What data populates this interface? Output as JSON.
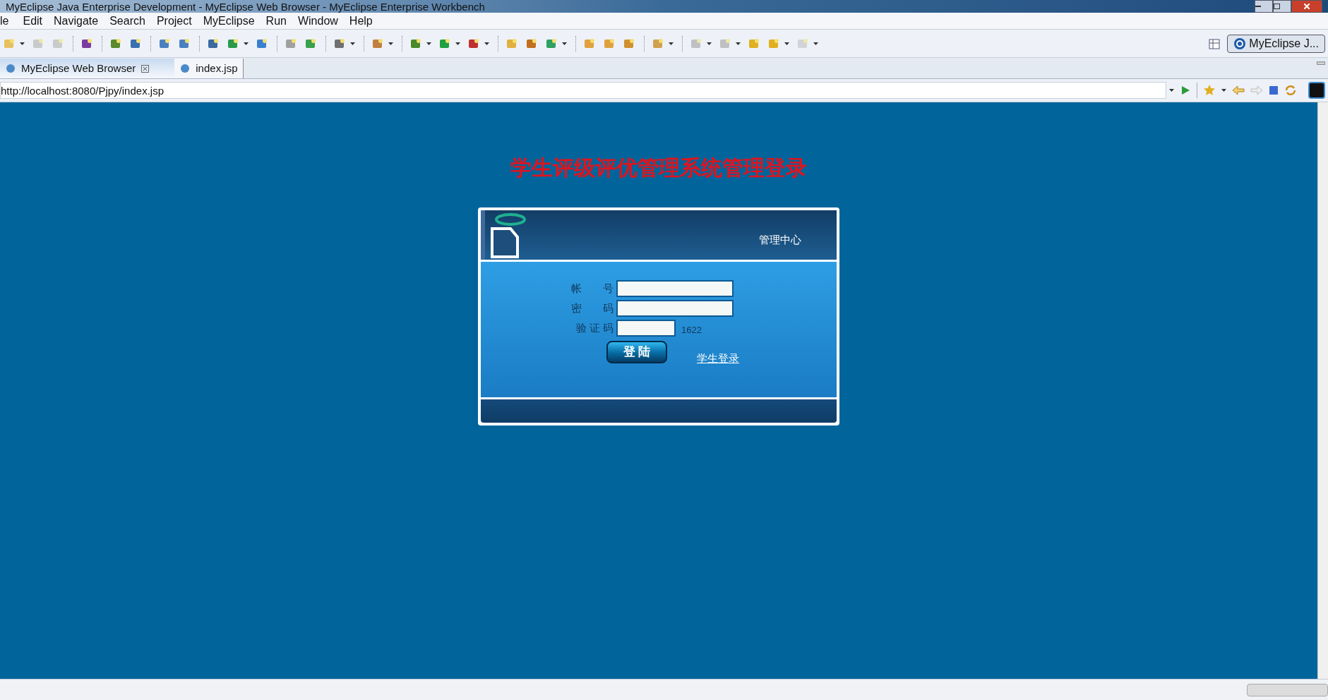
{
  "window": {
    "title": "MyEclipse Java Enterprise Development - MyEclipse Web Browser - MyEclipse Enterprise Workbench"
  },
  "menu": [
    "le",
    "Edit",
    "Navigate",
    "Search",
    "Project",
    "MyEclipse",
    "Run",
    "Window",
    "Help"
  ],
  "perspective": {
    "label": "MyEclipse J..."
  },
  "tabs": [
    {
      "label": "MyEclipse Web Browser",
      "selected": true,
      "closable": true
    },
    {
      "label": "index.jsp",
      "selected": false,
      "closable": false
    }
  ],
  "address": {
    "value": "http://localhost:8080/Pjpy/index.jsp"
  },
  "page": {
    "heading": "学生评级评优管理系统管理登录",
    "panel_title": "管理中心",
    "fields": [
      {
        "label": "帐　　号",
        "kind": "text"
      },
      {
        "label": "密　　码",
        "kind": "password"
      },
      {
        "label": "验 证 码",
        "kind": "captcha"
      }
    ],
    "captcha": "1622",
    "login_button": "登 陆",
    "student_link": "学生登录"
  }
}
